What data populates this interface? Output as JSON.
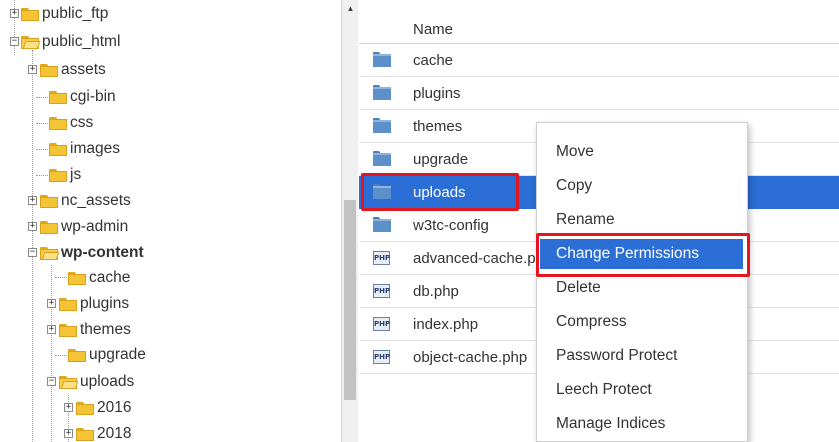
{
  "tree": {
    "items": [
      {
        "label": "public_ftp"
      },
      {
        "label": "public_html"
      },
      {
        "label": "assets"
      },
      {
        "label": "cgi-bin"
      },
      {
        "label": "css"
      },
      {
        "label": "images"
      },
      {
        "label": "js"
      },
      {
        "label": "nc_assets"
      },
      {
        "label": "wp-admin"
      },
      {
        "label": "wp-content"
      },
      {
        "label": "cache"
      },
      {
        "label": "plugins"
      },
      {
        "label": "themes"
      },
      {
        "label": "upgrade"
      },
      {
        "label": "uploads"
      },
      {
        "label": "2016"
      },
      {
        "label": "2018"
      }
    ]
  },
  "file_list": {
    "header": "Name",
    "rows": [
      {
        "name": "cache",
        "icon": "folder-icon"
      },
      {
        "name": "plugins",
        "icon": "folder-icon"
      },
      {
        "name": "themes",
        "icon": "folder-icon"
      },
      {
        "name": "upgrade",
        "icon": "folder-icon"
      },
      {
        "name": "uploads",
        "icon": "folder-icon",
        "selected": true
      },
      {
        "name": "w3tc-config",
        "icon": "folder-icon"
      },
      {
        "name": "advanced-cache.php",
        "icon": "php-file-icon"
      },
      {
        "name": "db.php",
        "icon": "php-file-icon"
      },
      {
        "name": "index.php",
        "icon": "php-file-icon"
      },
      {
        "name": "object-cache.php",
        "icon": "php-file-icon"
      }
    ],
    "php_icon_text": "PHP"
  },
  "context_menu": {
    "items": [
      {
        "label": "Move"
      },
      {
        "label": "Copy"
      },
      {
        "label": "Rename"
      },
      {
        "label": "Change Permissions",
        "active": true
      },
      {
        "label": "Delete"
      },
      {
        "label": "Compress"
      },
      {
        "label": "Password Protect"
      },
      {
        "label": "Leech Protect"
      },
      {
        "label": "Manage Indices"
      }
    ]
  },
  "scrollbar": {
    "up_arrow": "▲"
  },
  "expander_symbols": {
    "collapsed": "+",
    "expanded": "−"
  },
  "colors": {
    "selection": "#2a6ed6",
    "highlight_box": "#e3151f",
    "tree_folder": "#f5c434",
    "list_folder": "#5d8fc8"
  }
}
